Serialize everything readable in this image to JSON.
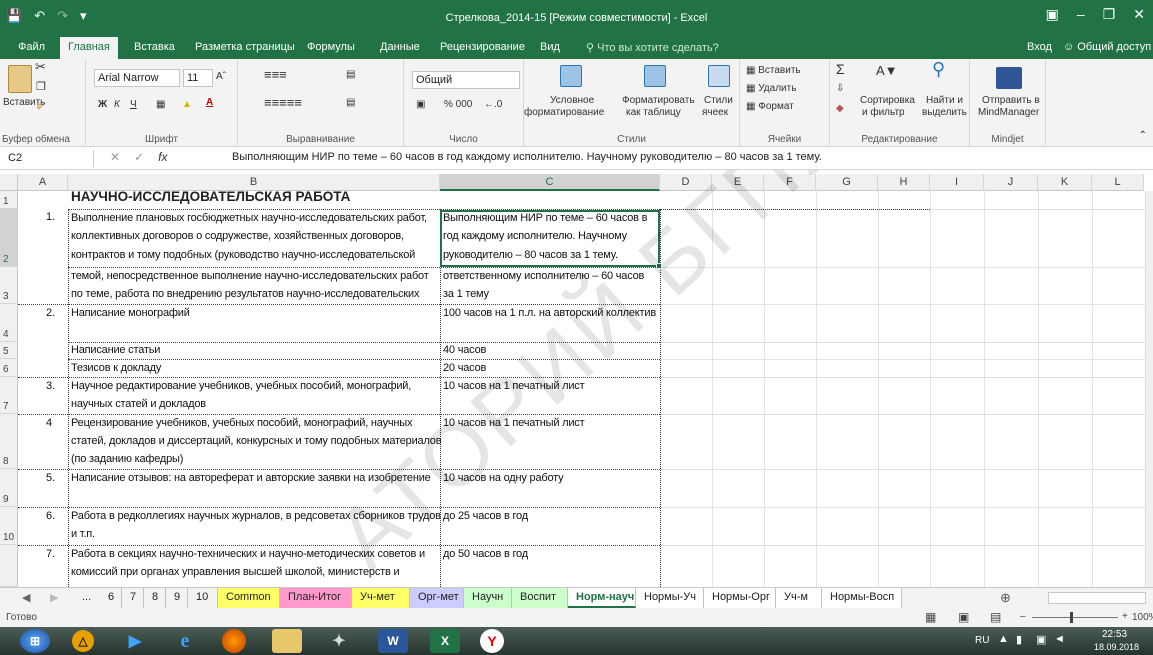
{
  "window": {
    "title": "Стрелкова_2014-15 [Режим совместимости] - Excel"
  },
  "tabs": [
    "Файл",
    "Главная",
    "Вставка",
    "Разметка страницы",
    "Формулы",
    "Данные",
    "Рецензирование",
    "Вид"
  ],
  "search_placeholder": "Что вы хотите сделать?",
  "signin": "Вход",
  "share": "Общий доступ",
  "ribbon": {
    "clipboard": {
      "paste": "Вставить",
      "label": "Буфер обмена"
    },
    "font": {
      "name": "Arial Narrow",
      "size": "11",
      "label": "Шрифт",
      "bold": "Ж",
      "italic": "К",
      "underline": "Ч"
    },
    "align": {
      "label": "Выравнивание"
    },
    "number": {
      "format": "Общий",
      "label": "Число",
      "percent": "% 000"
    },
    "styles": {
      "cond": "Условное",
      "cond2": "форматирование",
      "table": "Форматировать",
      "table2": "как таблицу",
      "cell": "Стили",
      "cell2": "ячеек",
      "label": "Стили"
    },
    "cells": {
      "insert": "Вставить",
      "delete": "Удалить",
      "format": "Формат",
      "label": "Ячейки"
    },
    "edit": {
      "sort": "Сортировка",
      "sort2": "и фильтр",
      "find": "Найти и",
      "find2": "выделить",
      "label": "Редактирование"
    },
    "mindjet": {
      "send": "Отправить в",
      "send2": "MindManager",
      "label": "Mindjet"
    }
  },
  "namebox": "C2",
  "formula": "Выполняющим НИР по теме – 60 часов в год каждому исполнителю. Научному руководителю – 80 часов за 1 тему.",
  "columns": [
    "A",
    "B",
    "C",
    "D",
    "E",
    "F",
    "G",
    "H",
    "I",
    "J",
    "K",
    "L"
  ],
  "rows": [
    "1",
    "2",
    "3",
    "4",
    "5",
    "6",
    "7",
    "8",
    "9",
    "10"
  ],
  "cells": {
    "heading": "НАУЧНО-ИССЛЕДОВАТЕЛЬСКАЯ РАБОТА",
    "n1": "1.",
    "b2": [
      "Выполнение плановых госбюджетных научно-исследовательских работ,",
      "коллективных договоров о содружестве, хозяйственных договоров,",
      "контрактов и тому подобных (руководство научно-исследовательской"
    ],
    "b3": [
      "темой, непосредственное  выполнение научно-исследовательских работ",
      "по теме, работа по внедрению результатов научно-исследовательских"
    ],
    "c2": [
      "Выполняющим НИР по теме – 60 часов в",
      "год каждому исполнителю. Научному",
      "руководителю – 80 часов за 1 тему."
    ],
    "c3": [
      "ответственному исполнителю – 60 часов",
      "за 1 тему"
    ],
    "n2": "2.",
    "b4": "Написание монографий",
    "c4": "100 часов на 1 п.л. на авторский коллектив",
    "b5": "Написание статьи",
    "c5": "40 часов",
    "b6": "Тезисов к докладу",
    "c6": "20 часов",
    "n3": "3.",
    "b7": [
      "Научное редактирование учебников, учебных пособий, монографий,",
      "научных статей и докладов"
    ],
    "c7": "10 часов на 1 печатный лист",
    "n4": "4",
    "b8": [
      "Рецензирование учебников, учебных пособий, монографий, научных",
      "статей, докладов и диссертаций, конкурсных и тому подобных материалов",
      "(по заданию кафедры)"
    ],
    "c8": "10 часов на 1 печатный лист",
    "n5": "5.",
    "b9": "Написание отзывов: на автореферат и авторские заявки  на изобретение",
    "c9": "10 часов на одну работу",
    "n6": "6.",
    "b10": [
      "Работа в редколлегиях научных журналов, в редсоветах сборников трудов",
      "и т.п."
    ],
    "c10": " до 25 часов в год",
    "n7": "7.",
    "b11": [
      "Работа в секциях научно-технических и научно-методических советов и",
      "комиссий при органах управления высшей школой, министерств и"
    ],
    "c11": "до 50 часов в год"
  },
  "watermark": "АТОРИЙ БГПУ",
  "sheets": [
    {
      "label": "...",
      "color": ""
    },
    {
      "label": "6",
      "color": ""
    },
    {
      "label": "7",
      "color": ""
    },
    {
      "label": "8",
      "color": ""
    },
    {
      "label": "9",
      "color": ""
    },
    {
      "label": "10",
      "color": ""
    },
    {
      "label": "Common",
      "color": "#ffff66"
    },
    {
      "label": "План-Итог",
      "color": "#ff99cc"
    },
    {
      "label": "Уч-мет",
      "color": "#ffff66"
    },
    {
      "label": "Орг-мет",
      "color": "#ccccff"
    },
    {
      "label": "Научн",
      "color": "#ccffcc"
    },
    {
      "label": "Воспит",
      "color": "#ccffcc"
    },
    {
      "label": "Норм-науч",
      "color": "#ffffff"
    },
    {
      "label": "Нормы-Уч",
      "color": "#ffffff"
    },
    {
      "label": "Нормы-Орг",
      "color": "#ffffff"
    },
    {
      "label": "Уч-м",
      "color": "#ffffff"
    },
    {
      "label": "Нормы-Восп",
      "color": "#ffffff"
    }
  ],
  "status": {
    "ready": "Готово",
    "zoom": "100%"
  },
  "taskbar": {
    "lang": "RU",
    "time": "22:53",
    "date": "18.09.2018"
  },
  "accent": "#217346"
}
